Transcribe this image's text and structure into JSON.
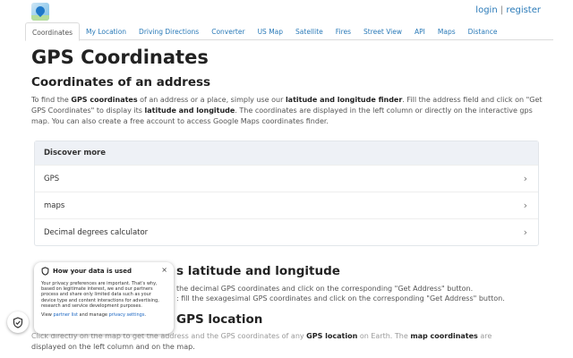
{
  "header": {
    "logo_icon": "gps-map-pin-logo",
    "login": "login",
    "separator": "|",
    "register": "register"
  },
  "tabs": [
    {
      "label": "Coordinates",
      "active": true
    },
    {
      "label": "My Location",
      "active": false
    },
    {
      "label": "Driving Directions",
      "active": false
    },
    {
      "label": "Converter",
      "active": false
    },
    {
      "label": "US Map",
      "active": false
    },
    {
      "label": "Satellite",
      "active": false
    },
    {
      "label": "Fires",
      "active": false
    },
    {
      "label": "Street View",
      "active": false
    },
    {
      "label": "API",
      "active": false
    },
    {
      "label": "Maps",
      "active": false
    },
    {
      "label": "Distance",
      "active": false
    }
  ],
  "main": {
    "title": "GPS Coordinates",
    "subtitle": "Coordinates of an address",
    "intro": {
      "p1": "To find the ",
      "b1": "GPS coordinates",
      "p2": " of an address or a place, simply use our ",
      "b2": "latitude and longitude finder",
      "p3": ". Fill the address field and click on \"Get GPS Coordinates\" to display its ",
      "b3": "latitude and longitude",
      "p4": ". The coordinates are displayed in the left column or directly on the interactive gps map. You can also create a free account to access Google Maps coordinates finder."
    }
  },
  "discover": {
    "heading": "Discover more",
    "items": [
      "GPS",
      "maps",
      "Decimal degrees calculator"
    ]
  },
  "section2": {
    "heading_visible": "s latitude and longitude",
    "line1": "the decimal GPS coordinates and click on the corresponding \"Get Address\" button.",
    "line2": ": fill the sexagesimal GPS coordinates and click on the corresponding \"Get Address\" button."
  },
  "section3": {
    "heading_visible": "GPS location",
    "line1_a": "Click directly on the map to get the address and the GPS coordinates of any ",
    "line1_b": "GPS location",
    "line1_c": " on Earth. The ",
    "line1_d": "map coordinates",
    "line1_e": " are",
    "line2": "displayed on the left column and on the map."
  },
  "privacy": {
    "title": "How your data is used",
    "body": "Your privacy preferences are important. That's why, based on legitimate interest, we and our partners process and share only limited data such as your device type and content interactions for advertising, research and service development purposes.",
    "foot_a": "View ",
    "partner_link": "partner list",
    "foot_b": " and manage ",
    "privacy_link": "privacy settings",
    "foot_c": ".",
    "close": "×"
  }
}
